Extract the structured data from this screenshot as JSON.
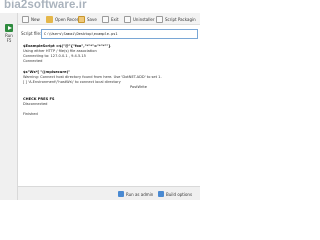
{
  "watermark": {
    "text": "bia2software.ir"
  },
  "left_pane": {
    "run_label": "Run",
    "run_sublabel": "F5"
  },
  "toolbar": {
    "buttons": [
      {
        "label": "New",
        "icon": "new-file-icon"
      },
      {
        "label": "Open Recent",
        "icon": "open-folder-icon"
      },
      {
        "label": "Save",
        "icon": "save-icon"
      },
      {
        "label": "Exit",
        "icon": "exit-icon"
      },
      {
        "label": "Uninstaller",
        "icon": "uninstall-icon"
      },
      {
        "label": "Script Packagin",
        "icon": "package-icon"
      }
    ]
  },
  "file": {
    "label": "Script file:",
    "value": "C:\\Users\\Samai\\Desktop\\example.ps1"
  },
  "output": {
    "lines": [
      "$ExampleScript =$(\"@\"{\"foo\",\"*\"*\"=\"*\"*\"\"}",
      "Using either HTTP / file(s) file association",
      "Connecting to: 127.0.0.1 , 9.4.5.15",
      "Connected",
      "$s\"Ws*[ \"((mplsecure)\"",
      "Warning: Connect host directory found from here. Use 'DotNET.ADD' to set 1.",
      "[ ] 'A.Environment\\\"hostWs\\' to connect local directory",
      "PostWrite",
      "CHECK PRES FS",
      "Disconnected",
      "Finished"
    ]
  },
  "status": {
    "run_as_admin": "Run as admin",
    "build_options": "Build options"
  }
}
